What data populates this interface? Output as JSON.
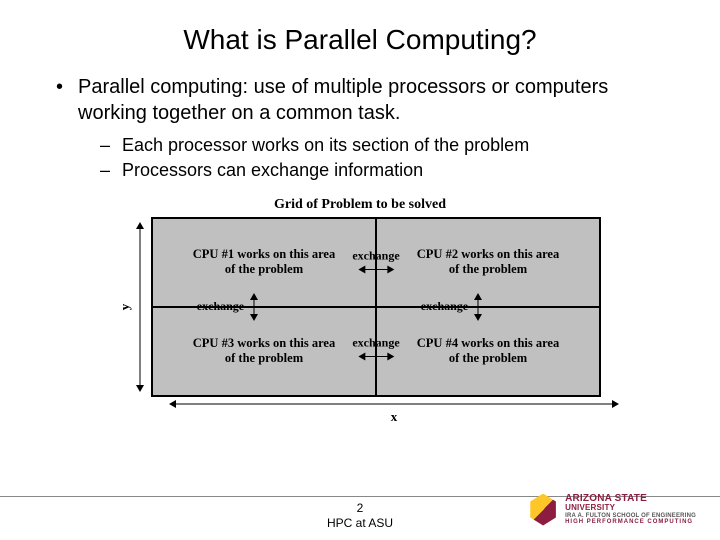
{
  "title": "What is Parallel Computing?",
  "bullet": "Parallel computing: use of multiple processors or computers working together on a common task.",
  "subs": [
    "Each processor works on its section of the problem",
    "Processors can exchange information"
  ],
  "diagram": {
    "title": "Grid of Problem to be solved",
    "y_label": "y",
    "x_label": "x",
    "cells": [
      {
        "line1": "CPU #1 works on this area",
        "line2": "of the problem"
      },
      {
        "line1": "CPU #2 works on this area",
        "line2": "of the problem"
      },
      {
        "line1": "CPU #3 works on this area",
        "line2": "of the problem"
      },
      {
        "line1": "CPU #4 works on this area",
        "line2": "of the problem"
      }
    ],
    "exchange_label": "exchange"
  },
  "footer": {
    "page": "2",
    "caption": "HPC at ASU"
  },
  "logo": {
    "line1": "ARIZONA STATE",
    "line2": "UNIVERSITY",
    "line3": "IRA A. FULTON SCHOOL OF ENGINEERING",
    "line4": "HIGH PERFORMANCE COMPUTING"
  }
}
